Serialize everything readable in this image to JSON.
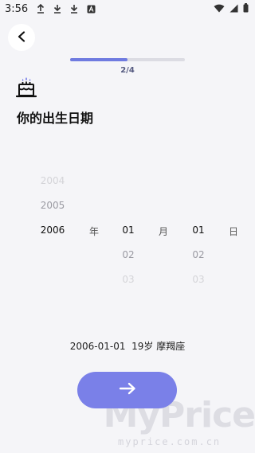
{
  "status_bar": {
    "time": "3:56"
  },
  "progress": {
    "step_label": "2/4",
    "fraction": 0.5
  },
  "title": "你的出生日期",
  "picker": {
    "years": {
      "above2": "2004",
      "above1": "2005",
      "selected": "2006",
      "unit": "年"
    },
    "months": {
      "selected": "01",
      "below1": "02",
      "below2": "03",
      "unit": "月"
    },
    "days": {
      "selected": "01",
      "below1": "02",
      "below2": "03",
      "unit": "日"
    }
  },
  "summary": "2006-01-01  19岁 摩羯座",
  "next_button_icon": "arrow-right-icon",
  "watermark": {
    "main": "MyPrice",
    "sub": "myprice.com.cn"
  },
  "colors": {
    "accent": "#7a80e8",
    "progress": "#6f7be0",
    "background": "#f5f5f8"
  }
}
